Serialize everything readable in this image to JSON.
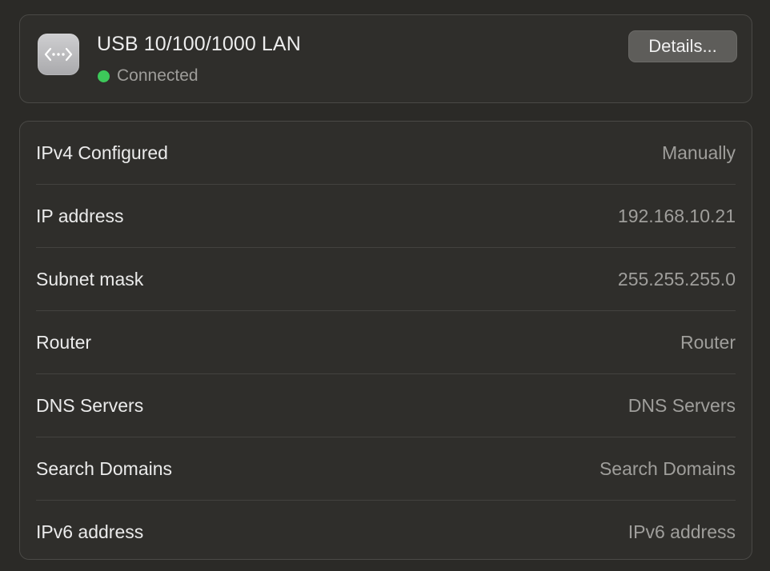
{
  "header": {
    "interface_name": "USB 10/100/1000 LAN",
    "status": "Connected",
    "details_button": "Details..."
  },
  "colors": {
    "status_connected": "#3dc85a"
  },
  "icons": {
    "interface": "network-ethernet-icon"
  },
  "rows": [
    {
      "label": "IPv4 Configured",
      "value": "Manually"
    },
    {
      "label": "IP address",
      "value": "192.168.10.21"
    },
    {
      "label": "Subnet mask",
      "value": "255.255.255.0"
    },
    {
      "label": "Router",
      "value": "Router"
    },
    {
      "label": "DNS Servers",
      "value": "DNS Servers"
    },
    {
      "label": "Search Domains",
      "value": "Search Domains"
    },
    {
      "label": "IPv6 address",
      "value": "IPv6 address"
    }
  ]
}
